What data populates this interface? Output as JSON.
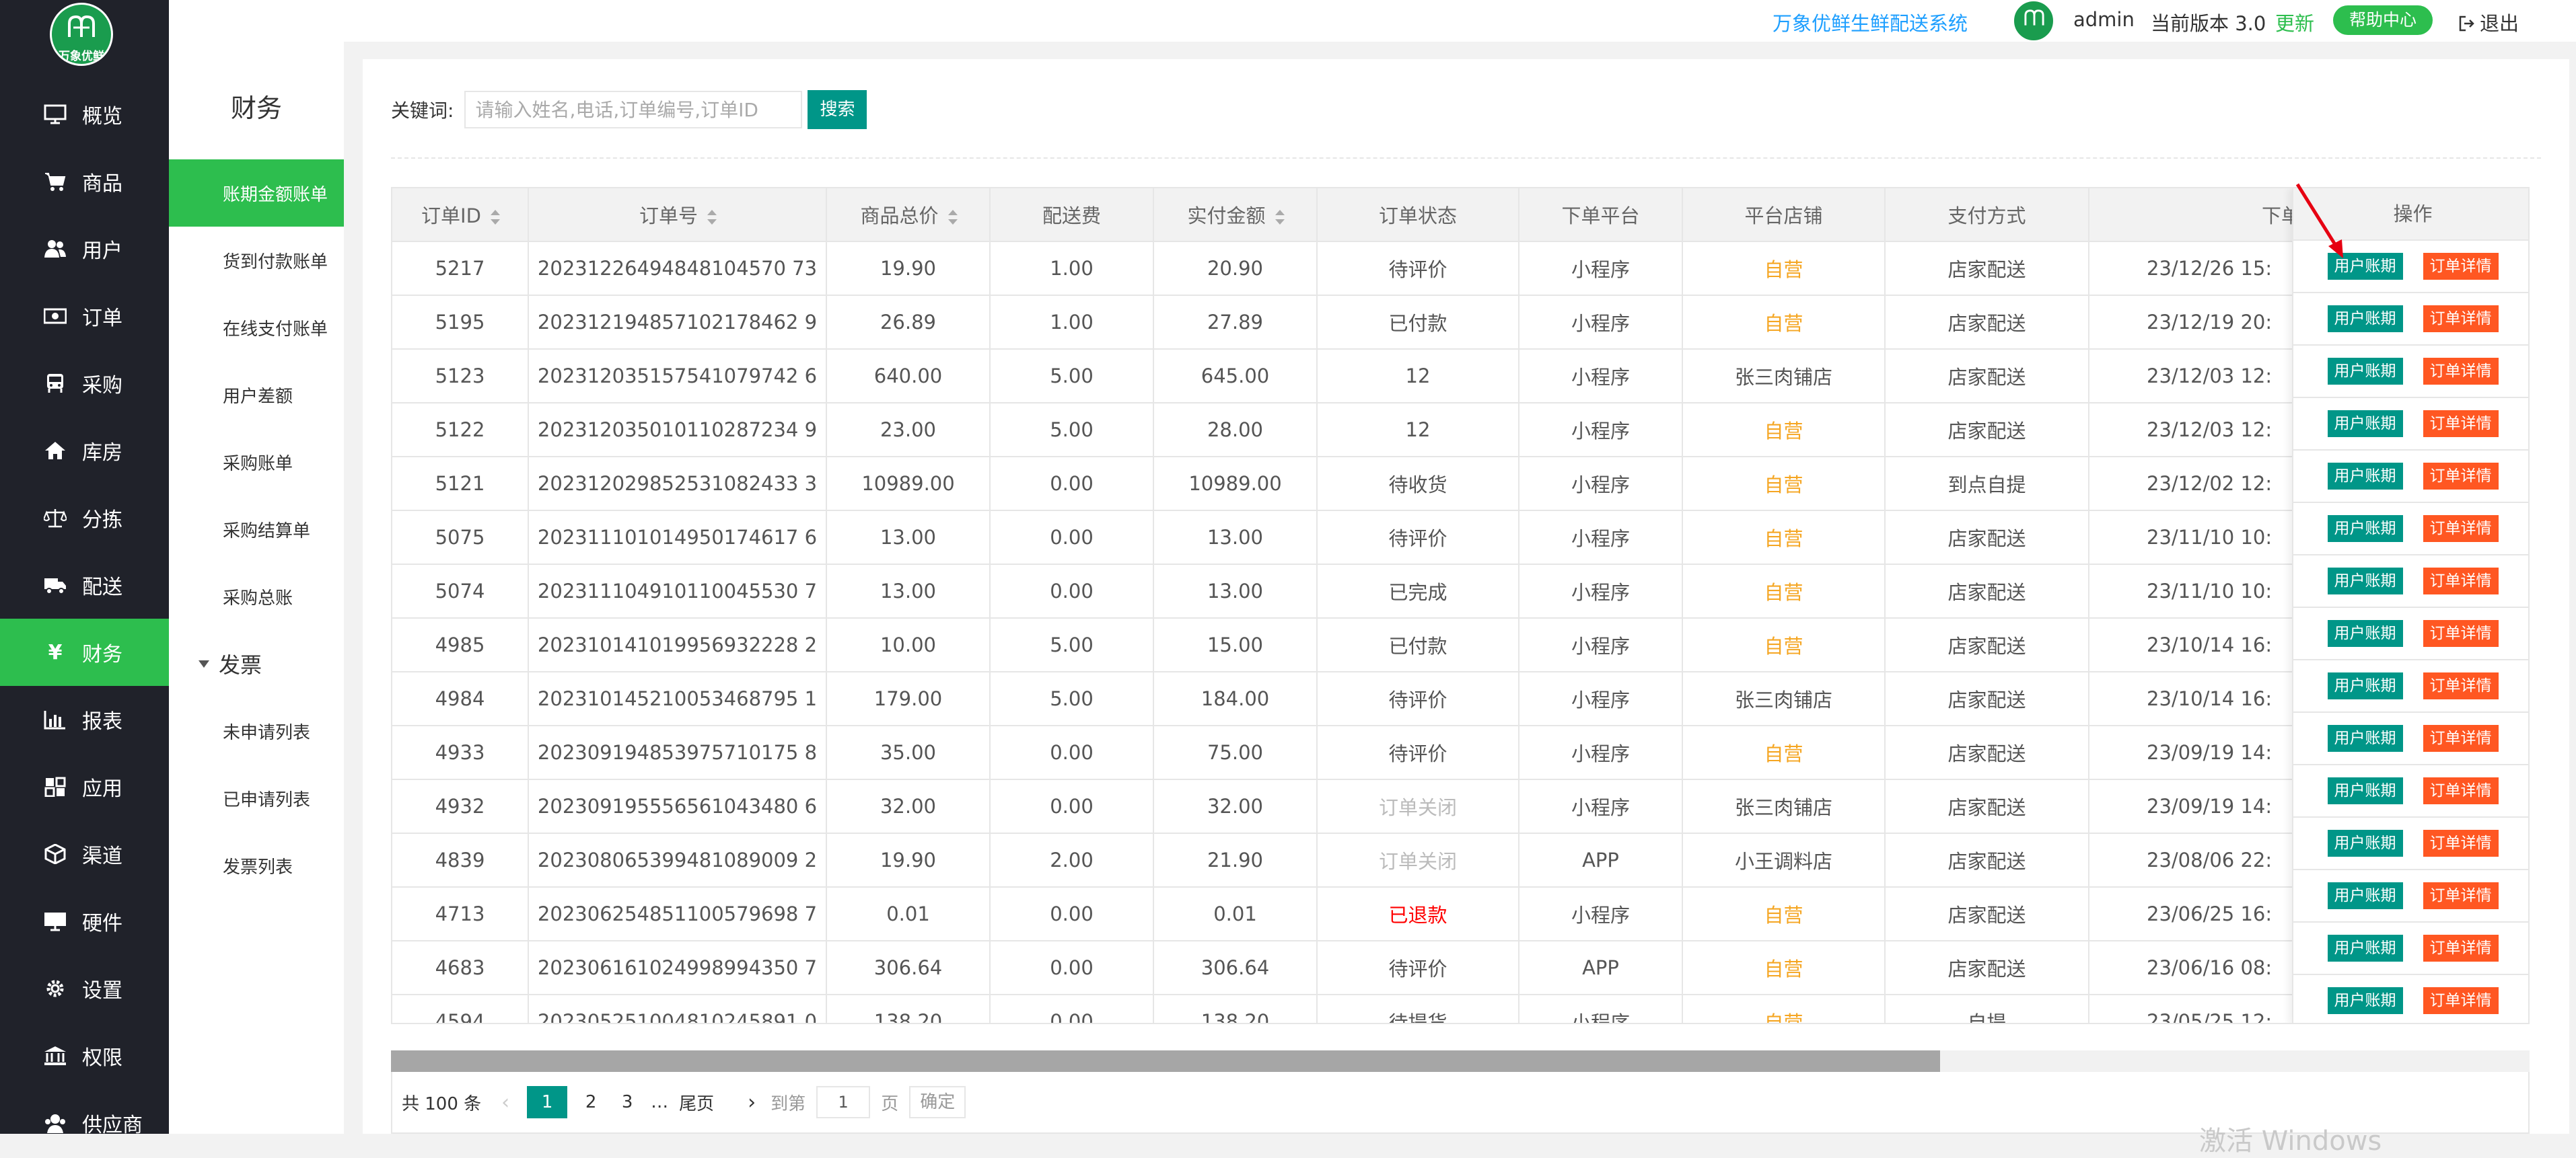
{
  "brand": {
    "logo_text": "万象优鲜",
    "accent": "#2dbe4e",
    "teal": "#009688",
    "orange": "#ff5722"
  },
  "header": {
    "system_title": "万象优鲜生鲜配送系统",
    "username": "admin",
    "version_text": "当前版本 3.0",
    "update_label": "更新",
    "help_label": "帮助中心",
    "logout_label": "退出"
  },
  "nav": {
    "items": [
      {
        "label": "概览",
        "icon": "monitor-icon"
      },
      {
        "label": "商品",
        "icon": "cart-icon"
      },
      {
        "label": "用户",
        "icon": "users-icon"
      },
      {
        "label": "订单",
        "icon": "money-icon"
      },
      {
        "label": "采购",
        "icon": "bus-icon"
      },
      {
        "label": "库房",
        "icon": "home-icon"
      },
      {
        "label": "分拣",
        "icon": "scale-icon"
      },
      {
        "label": "配送",
        "icon": "truck-icon"
      },
      {
        "label": "财务",
        "icon": "yen-icon"
      },
      {
        "label": "报表",
        "icon": "bar-chart-icon"
      },
      {
        "label": "应用",
        "icon": "apps-icon"
      },
      {
        "label": "渠道",
        "icon": "cube-icon"
      },
      {
        "label": "硬件",
        "icon": "desktop-icon"
      },
      {
        "label": "设置",
        "icon": "gear-icon"
      },
      {
        "label": "权限",
        "icon": "bank-icon"
      },
      {
        "label": "供应商",
        "icon": "supplier-icon"
      }
    ],
    "active_label": "财务"
  },
  "subnav": {
    "title": "财务",
    "items": [
      "账期金额账单",
      "货到付款账单",
      "在线支付账单",
      "用户差额",
      "采购账单",
      "采购结算单",
      "采购总账"
    ],
    "group": "发票",
    "group_items": [
      "未申请列表",
      "已申请列表",
      "发票列表"
    ]
  },
  "search": {
    "label": "关键词:",
    "placeholder": "请输入姓名,电话,订单编号,订单ID",
    "value": "",
    "button": "搜索"
  },
  "table": {
    "columns": [
      "订单ID",
      "订单号",
      "商品总价",
      "配送费",
      "实付金额",
      "订单状态",
      "下单平台",
      "平台店铺",
      "支付方式",
      "下单时间"
    ],
    "ops_header": "操作",
    "btn_account": "用户账期",
    "btn_detail": "订单详情",
    "rows": [
      {
        "id": "5217",
        "no": "20231226494848104570 73",
        "total": "19.90",
        "fee": "1.00",
        "paid": "20.90",
        "status": "待评价",
        "platform": "小程序",
        "store": "自营",
        "pay": "店家配送",
        "time": "23/12/26 15:"
      },
      {
        "id": "5195",
        "no": "202312194857102178462 9",
        "total": "26.89",
        "fee": "1.00",
        "paid": "27.89",
        "status": "已付款",
        "platform": "小程序",
        "store": "自营",
        "pay": "店家配送",
        "time": "23/12/19 20:"
      },
      {
        "id": "5123",
        "no": "202312035157541079742 6",
        "total": "640.00",
        "fee": "5.00",
        "paid": "645.00",
        "status": "12",
        "platform": "小程序",
        "store": "张三肉铺店",
        "pay": "店家配送",
        "time": "23/12/03 12:"
      },
      {
        "id": "5122",
        "no": "202312035010110287234 9",
        "total": "23.00",
        "fee": "5.00",
        "paid": "28.00",
        "status": "12",
        "platform": "小程序",
        "store": "自营",
        "pay": "店家配送",
        "time": "23/12/03 12:"
      },
      {
        "id": "5121",
        "no": "202312029852531082433 3",
        "total": "10989.00",
        "fee": "0.00",
        "paid": "10989.00",
        "status": "待收货",
        "platform": "小程序",
        "store": "自营",
        "pay": "到点自提",
        "time": "23/12/02 12:"
      },
      {
        "id": "5075",
        "no": "202311101014950174617 6",
        "total": "13.00",
        "fee": "0.00",
        "paid": "13.00",
        "status": "待评价",
        "platform": "小程序",
        "store": "自营",
        "pay": "店家配送",
        "time": "23/11/10 10:"
      },
      {
        "id": "5074",
        "no": "202311104910110045530 7",
        "total": "13.00",
        "fee": "0.00",
        "paid": "13.00",
        "status": "已完成",
        "platform": "小程序",
        "store": "自营",
        "pay": "店家配送",
        "time": "23/11/10 10:"
      },
      {
        "id": "4985",
        "no": "202310141019956932228 2",
        "total": "10.00",
        "fee": "5.00",
        "paid": "15.00",
        "status": "已付款",
        "platform": "小程序",
        "store": "自营",
        "pay": "店家配送",
        "time": "23/10/14 16:"
      },
      {
        "id": "4984",
        "no": "202310145210053468795 1",
        "total": "179.00",
        "fee": "5.00",
        "paid": "184.00",
        "status": "待评价",
        "platform": "小程序",
        "store": "张三肉铺店",
        "pay": "店家配送",
        "time": "23/10/14 16:"
      },
      {
        "id": "4933",
        "no": "202309194853975710175 8",
        "total": "35.00",
        "fee": "0.00",
        "paid": "75.00",
        "status": "待评价",
        "platform": "小程序",
        "store": "自营",
        "pay": "店家配送",
        "time": "23/09/19 14:"
      },
      {
        "id": "4932",
        "no": "202309195556561043480 6",
        "total": "32.00",
        "fee": "0.00",
        "paid": "32.00",
        "status": "订单关闭",
        "platform": "小程序",
        "store": "张三肉铺店",
        "pay": "店家配送",
        "time": "23/09/19 14:"
      },
      {
        "id": "4839",
        "no": "202308065399481089009 2",
        "total": "19.90",
        "fee": "2.00",
        "paid": "21.90",
        "status": "订单关闭",
        "platform": "APP",
        "store": "小王调料店",
        "pay": "店家配送",
        "time": "23/08/06 22:"
      },
      {
        "id": "4713",
        "no": "202306254851100579698 7",
        "total": "0.01",
        "fee": "0.00",
        "paid": "0.01",
        "status": "已退款",
        "platform": "小程序",
        "store": "自营",
        "pay": "店家配送",
        "time": "23/06/25 16:"
      },
      {
        "id": "4683",
        "no": "202306161024998994350 7",
        "total": "306.64",
        "fee": "0.00",
        "paid": "306.64",
        "status": "待评价",
        "platform": "APP",
        "store": "自营",
        "pay": "店家配送",
        "time": "23/06/16 08:"
      },
      {
        "id": "4594",
        "no": "202305251004810245891 0",
        "total": "138.20",
        "fee": "0.00",
        "paid": "138.20",
        "status": "待提货",
        "platform": "小程序",
        "store": "自营",
        "pay": "自提",
        "time": "23/05/25 12:"
      }
    ]
  },
  "pager": {
    "total": "共 100 条",
    "pages": [
      "1",
      "2",
      "3"
    ],
    "current": "1",
    "ellipsis": "…",
    "last": "尾页",
    "goto_label": "到第",
    "goto_value": "1",
    "page_unit": "页",
    "confirm": "确定"
  },
  "watermark": "激活 Windows"
}
